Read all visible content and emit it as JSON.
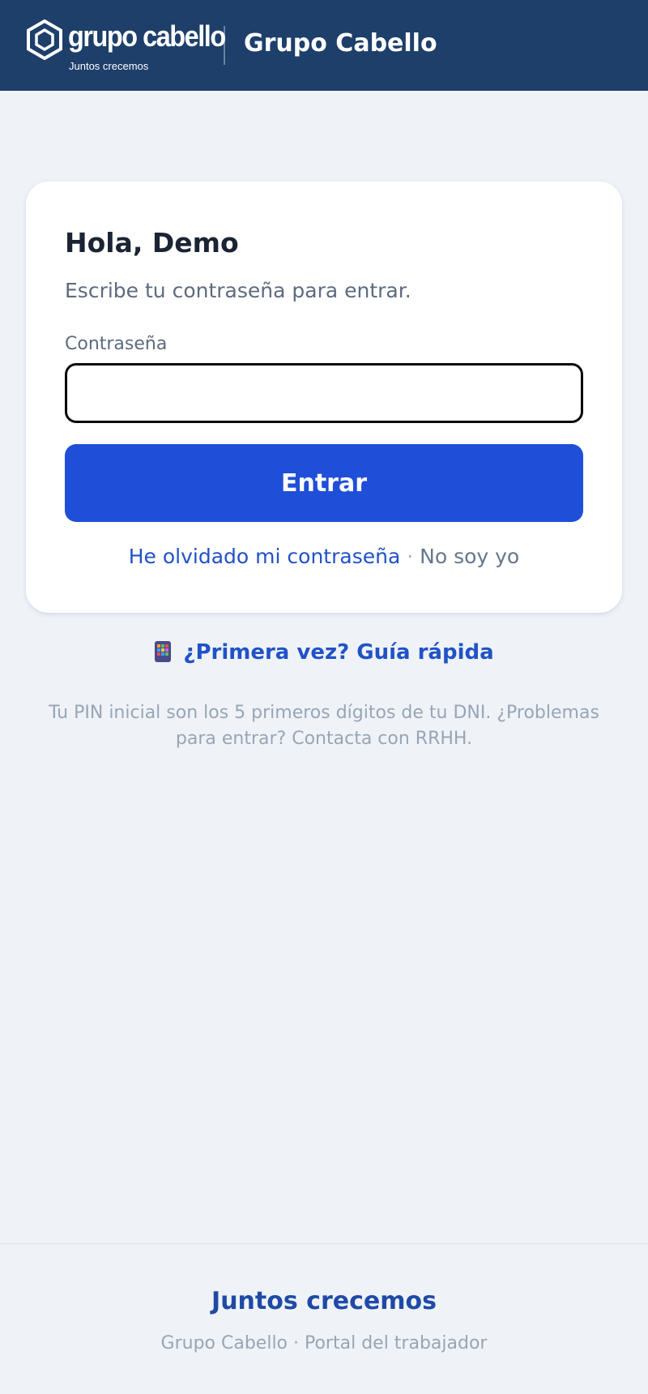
{
  "header": {
    "logo_wordmark": "grupo cabello",
    "logo_tagline": "Juntos crecemos",
    "title": "Grupo Cabello",
    "background_color": "#1d3f6a"
  },
  "login_card": {
    "greeting": "Hola, Demo",
    "subtitle": "Escribe tu contraseña para entrar.",
    "password_label": "Contraseña",
    "password_value": "",
    "submit_label": "Entrar",
    "forgot_password_link": "He olvidado mi contraseña",
    "separator": "·",
    "not_me_link": "No soy yo",
    "accent_color": "#1f4fd8"
  },
  "guide": {
    "icon": "phone-icon",
    "label": "¿Primera vez? Guía rápida"
  },
  "help_text": "Tu PIN inicial son los 5 primeros dígitos de tu DNI. ¿Problemas para entrar? Contacta con RRHH.",
  "footer": {
    "motto": "Juntos crecemos",
    "subtitle": "Grupo Cabello · Portal del trabajador"
  }
}
